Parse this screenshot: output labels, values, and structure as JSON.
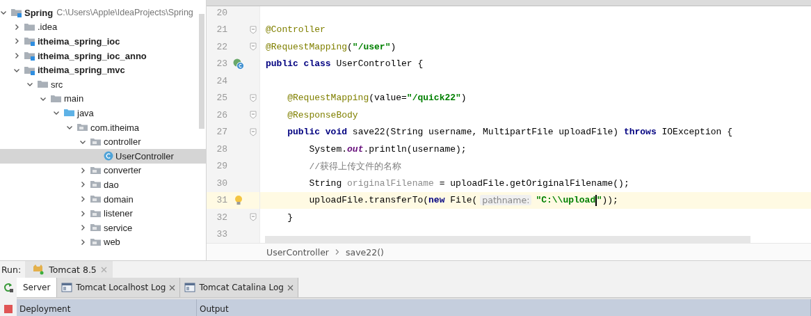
{
  "project_tree": [
    {
      "label": "Spring",
      "path": "C:\\Users\\Apple\\IdeaProjects\\Spring",
      "kind": "module",
      "expanded": true,
      "selected": false,
      "children": [
        {
          "label": ".idea",
          "kind": "folder",
          "expanded": false,
          "selected": false
        },
        {
          "label": "itheima_spring_ioc",
          "kind": "module",
          "expanded": false,
          "selected": false
        },
        {
          "label": "itheima_spring_ioc_anno",
          "kind": "module",
          "expanded": false,
          "selected": false
        },
        {
          "label": "itheima_spring_mvc",
          "kind": "module",
          "expanded": true,
          "selected": false,
          "children": [
            {
              "label": "src",
              "kind": "folder",
              "expanded": true,
              "selected": false,
              "children": [
                {
                  "label": "main",
                  "kind": "folder",
                  "expanded": true,
                  "selected": false,
                  "children": [
                    {
                      "label": "java",
                      "kind": "source",
                      "expanded": true,
                      "selected": false,
                      "children": [
                        {
                          "label": "com.itheima",
                          "kind": "package",
                          "expanded": true,
                          "selected": false,
                          "children": [
                            {
                              "label": "controller",
                              "kind": "package",
                              "expanded": true,
                              "selected": false,
                              "children": [
                                {
                                  "label": "UserController",
                                  "kind": "class",
                                  "selected": true
                                }
                              ]
                            },
                            {
                              "label": "converter",
                              "kind": "package",
                              "expanded": false,
                              "selected": false
                            },
                            {
                              "label": "dao",
                              "kind": "package",
                              "expanded": false,
                              "selected": false
                            },
                            {
                              "label": "domain",
                              "kind": "package",
                              "expanded": false,
                              "selected": false
                            },
                            {
                              "label": "listener",
                              "kind": "package",
                              "expanded": false,
                              "selected": false
                            },
                            {
                              "label": "service",
                              "kind": "package",
                              "expanded": false,
                              "selected": false
                            },
                            {
                              "label": "web",
                              "kind": "package",
                              "expanded": false,
                              "selected": false
                            }
                          ]
                        }
                      ]
                    }
                  ]
                }
              ]
            }
          ]
        }
      ]
    }
  ],
  "editor": {
    "lines": [
      {
        "number": "20"
      },
      {
        "number": "21",
        "fold": true,
        "tokens": [
          {
            "text": "@Controller",
            "kind": "annotation"
          }
        ]
      },
      {
        "number": "22",
        "fold": true,
        "tokens": [
          {
            "text": "@RequestMapping",
            "kind": "annotation"
          },
          {
            "text": "(",
            "kind": "plain"
          },
          {
            "text": "\"/user\"",
            "kind": "string"
          },
          {
            "text": ")",
            "kind": "plain"
          }
        ]
      },
      {
        "number": "23",
        "bean_marker": true,
        "tokens": [
          {
            "text": "public class ",
            "kind": "keyword"
          },
          {
            "text": "UserController {",
            "kind": "plain"
          }
        ]
      },
      {
        "number": "24"
      },
      {
        "number": "25",
        "fold": true,
        "tokens": [
          {
            "text": "    @RequestMapping",
            "kind": "annotation"
          },
          {
            "text": "(value=",
            "kind": "plain"
          },
          {
            "text": "\"/quick22\"",
            "kind": "string"
          },
          {
            "text": ")",
            "kind": "plain"
          }
        ]
      },
      {
        "number": "26",
        "fold": true,
        "tokens": [
          {
            "text": "    @ResponseBody",
            "kind": "annotation"
          }
        ]
      },
      {
        "number": "27",
        "fold": true,
        "tokens": [
          {
            "text": "    public void ",
            "kind": "keyword"
          },
          {
            "text": "save22(String username, MultipartFile uploadFile) ",
            "kind": "plain"
          },
          {
            "text": "throws ",
            "kind": "keyword"
          },
          {
            "text": "IOException {",
            "kind": "plain"
          }
        ]
      },
      {
        "number": "28",
        "tokens": [
          {
            "text": "        System.",
            "kind": "plain"
          },
          {
            "text": "out",
            "kind": "field"
          },
          {
            "text": ".println(username);",
            "kind": "plain"
          }
        ]
      },
      {
        "number": "29",
        "tokens": [
          {
            "text": "        //获得上传文件的名称",
            "kind": "comment"
          }
        ]
      },
      {
        "number": "30",
        "tokens": [
          {
            "text": "        String ",
            "kind": "plain"
          },
          {
            "text": "originalFilename",
            "kind": "unused"
          },
          {
            "text": " = uploadFile.getOriginalFilename();",
            "kind": "plain"
          }
        ]
      },
      {
        "number": "31",
        "current": true,
        "intention_bulb": true,
        "tokens": [
          {
            "text": "        uploadFile.transferTo(",
            "kind": "plain"
          },
          {
            "text": "new ",
            "kind": "keyword"
          },
          {
            "text": "File(",
            "kind": "plain"
          },
          {
            "text": "pathname:",
            "kind": "hint"
          },
          {
            "text": "\"C:\\\\upload",
            "kind": "string",
            "caret_after": true
          },
          {
            "text": "\"",
            "kind": "string"
          },
          {
            "text": "));",
            "kind": "plain"
          }
        ]
      },
      {
        "number": "32",
        "fold": true,
        "tokens": [
          {
            "text": "    }",
            "kind": "plain"
          }
        ]
      },
      {
        "number": "33"
      }
    ],
    "breadcrumbs": [
      "UserController",
      "save22()"
    ]
  },
  "run_panel": {
    "label": "Run:",
    "config_tab": {
      "label": "Tomcat 8.5"
    },
    "tabs": [
      {
        "label": "Server",
        "selected": true,
        "closable": false
      },
      {
        "label": "Tomcat Localhost Log",
        "selected": false,
        "closable": true
      },
      {
        "label": "Tomcat Catalina Log",
        "selected": false,
        "closable": true
      }
    ],
    "columns": [
      "Deployment",
      "Output"
    ]
  }
}
